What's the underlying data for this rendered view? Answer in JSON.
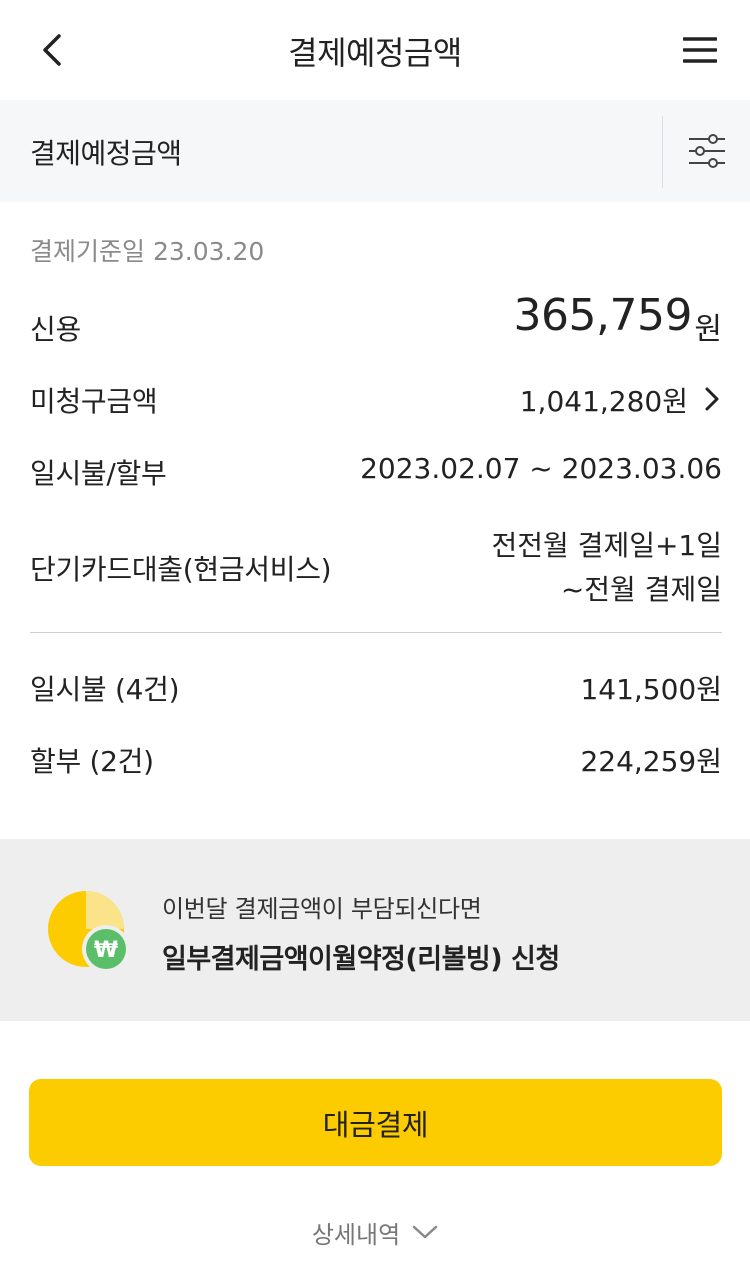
{
  "header": {
    "title": "결제예정금액",
    "back_icon": "chevron-left-icon",
    "menu_icon": "hamburger-menu-icon"
  },
  "section": {
    "title": "결제예정금액",
    "filter_icon": "filter-sliders-icon"
  },
  "summary": {
    "base_date": "결제기준일 23.03.20",
    "credit_label": "신용",
    "credit_amount": "365,759",
    "credit_unit": "원",
    "unbilled_label": "미청구금액",
    "unbilled_amount": "1,041,280원",
    "lump_period_label": "일시불/할부",
    "lump_period_value": "2023.02.07 ~ 2023.03.06",
    "cash_label": "단기카드대출(현금서비스)",
    "cash_value_line1": "전전월 결제일+1일",
    "cash_value_line2": "~전월 결제일"
  },
  "breakdown": {
    "lump_label": "일시불 (4건)",
    "lump_amount": "141,500원",
    "install_label": "할부 (2건)",
    "install_amount": "224,259원"
  },
  "banner": {
    "subtitle": "이번달 결제금액이 부담되신다면",
    "title": "일부결제금액이월약정(리볼빙) 신청",
    "icon": "revolving-pie-won-icon",
    "colors": {
      "pie": "#fccb00",
      "pie_light": "#fbe38a",
      "badge": "#5bbf6a"
    }
  },
  "actions": {
    "pay_label": "대금결제",
    "detail_label": "상세내역",
    "pay_color": "#fccb00"
  }
}
